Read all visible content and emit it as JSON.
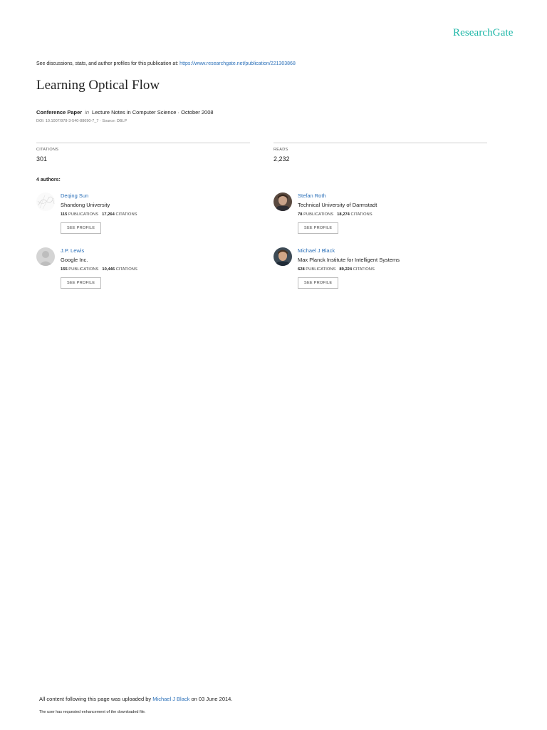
{
  "brand": "ResearchGate",
  "header": {
    "discussion_text": "See discussions, stats, and author profiles for this publication at: ",
    "publication_url": "https://www.researchgate.net/publication/221303868"
  },
  "paper": {
    "title": "Learning Optical Flow",
    "type": "Conference Paper",
    "in_word": "in",
    "venue": "Lecture Notes in Computer Science · October 2008",
    "doi_source": "DOI: 10.1007/978-3-540-88690-7_7 · Source: DBLP"
  },
  "stats": {
    "citations_label": "CITATIONS",
    "citations_value": "301",
    "reads_label": "READS",
    "reads_value": "2,232"
  },
  "authors_header": "4 authors:",
  "labels": {
    "publications": "PUBLICATIONS",
    "citations": "CITATIONS",
    "see_profile": "SEE PROFILE"
  },
  "authors": [
    {
      "name": "Deqing Sun",
      "institution": "Shandong University",
      "publications": "115",
      "citations": "17,264"
    },
    {
      "name": "Stefan Roth",
      "institution": "Technical University of Darmstadt",
      "publications": "78",
      "citations": "18,274"
    },
    {
      "name": "J.P. Lewis",
      "institution": "Google Inc.",
      "publications": "155",
      "citations": "10,446"
    },
    {
      "name": "Michael J Black",
      "institution": "Max Planck Institute for Intelligent Systems",
      "publications": "628",
      "citations": "89,224"
    }
  ],
  "footer": {
    "uploaded_prefix": "All content following this page was uploaded by ",
    "uploader": "Michael J Black",
    "uploaded_suffix": " on 03 June 2014.",
    "note": "The user has requested enhancement of the downloaded file."
  }
}
